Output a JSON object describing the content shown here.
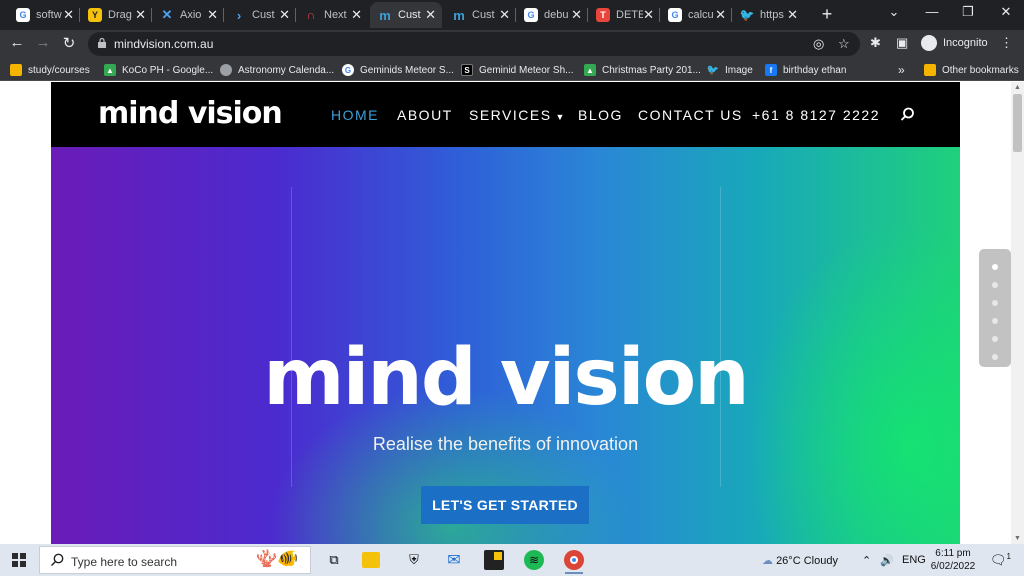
{
  "browser": {
    "tabs": [
      {
        "title": "softw",
        "icon": "google-icon",
        "color": "#ffffff"
      },
      {
        "title": "Drag",
        "icon": "y-icon",
        "color": "#f4c20d"
      },
      {
        "title": "Axio",
        "icon": "x-icon",
        "color": "#4aa3f0"
      },
      {
        "title": "Cust",
        "icon": "chevron-icon",
        "color": "#4aa3f0"
      },
      {
        "title": "Next",
        "icon": "n-icon",
        "color": "#e8453c"
      },
      {
        "title": "Cust",
        "icon": "m-icon",
        "color": "#3b9fd8",
        "active": true
      },
      {
        "title": "Cust",
        "icon": "m-icon",
        "color": "#3b9fd8"
      },
      {
        "title": "debu",
        "icon": "google-icon",
        "color": "#ffffff"
      },
      {
        "title": "DETE",
        "icon": "t-icon",
        "color": "#e8453c"
      },
      {
        "title": "calcu",
        "icon": "google-icon",
        "color": "#ffffff"
      },
      {
        "title": "https",
        "icon": "twitter-icon",
        "color": "#1da1f2"
      }
    ],
    "url": "mindvision.com.au",
    "profile": "Incognito",
    "bookmarks": [
      {
        "label": "study/courses",
        "icon": "folder-icon",
        "color": "#f4b400"
      },
      {
        "label": "KoCo PH - Google...",
        "icon": "drive-icon",
        "color": "#34a853"
      },
      {
        "label": "Astronomy Calenda...",
        "icon": "globe-icon",
        "color": "#9aa0a6"
      },
      {
        "label": "Geminids Meteor S...",
        "icon": "google-icon",
        "color": "#ffffff"
      },
      {
        "label": "Geminid Meteor Sh...",
        "icon": "s-icon",
        "color": "#000000"
      },
      {
        "label": "Christmas Party 201...",
        "icon": "drive-icon",
        "color": "#34a853"
      },
      {
        "label": "Image",
        "icon": "twitter-icon",
        "color": "#1da1f2"
      },
      {
        "label": "birthday ethan",
        "icon": "facebook-icon",
        "color": "#1877f2"
      }
    ],
    "overflow": "»",
    "other_bookmarks": "Other bookmarks"
  },
  "site": {
    "logo": "mind vision",
    "nav": {
      "home": "HOME",
      "about": "ABOUT",
      "services": "SERVICES",
      "blog": "BLOG",
      "contact": "CONTACT US",
      "phone": "+61 8 8127 2222"
    },
    "hero": {
      "title": "mind vision",
      "subtitle": "Realise the benefits of innovation",
      "cta": "LET'S GET STARTED"
    },
    "slider_dots": 6,
    "active_dot": 1,
    "accent": "#3b9fd8",
    "cta_color": "#1b6fc4"
  },
  "taskbar": {
    "search_placeholder": "Type here to search",
    "weather": "26°C  Cloudy",
    "lang": "ENG",
    "time": "6:11 pm",
    "date": "6/02/2022",
    "notifications": "1"
  }
}
